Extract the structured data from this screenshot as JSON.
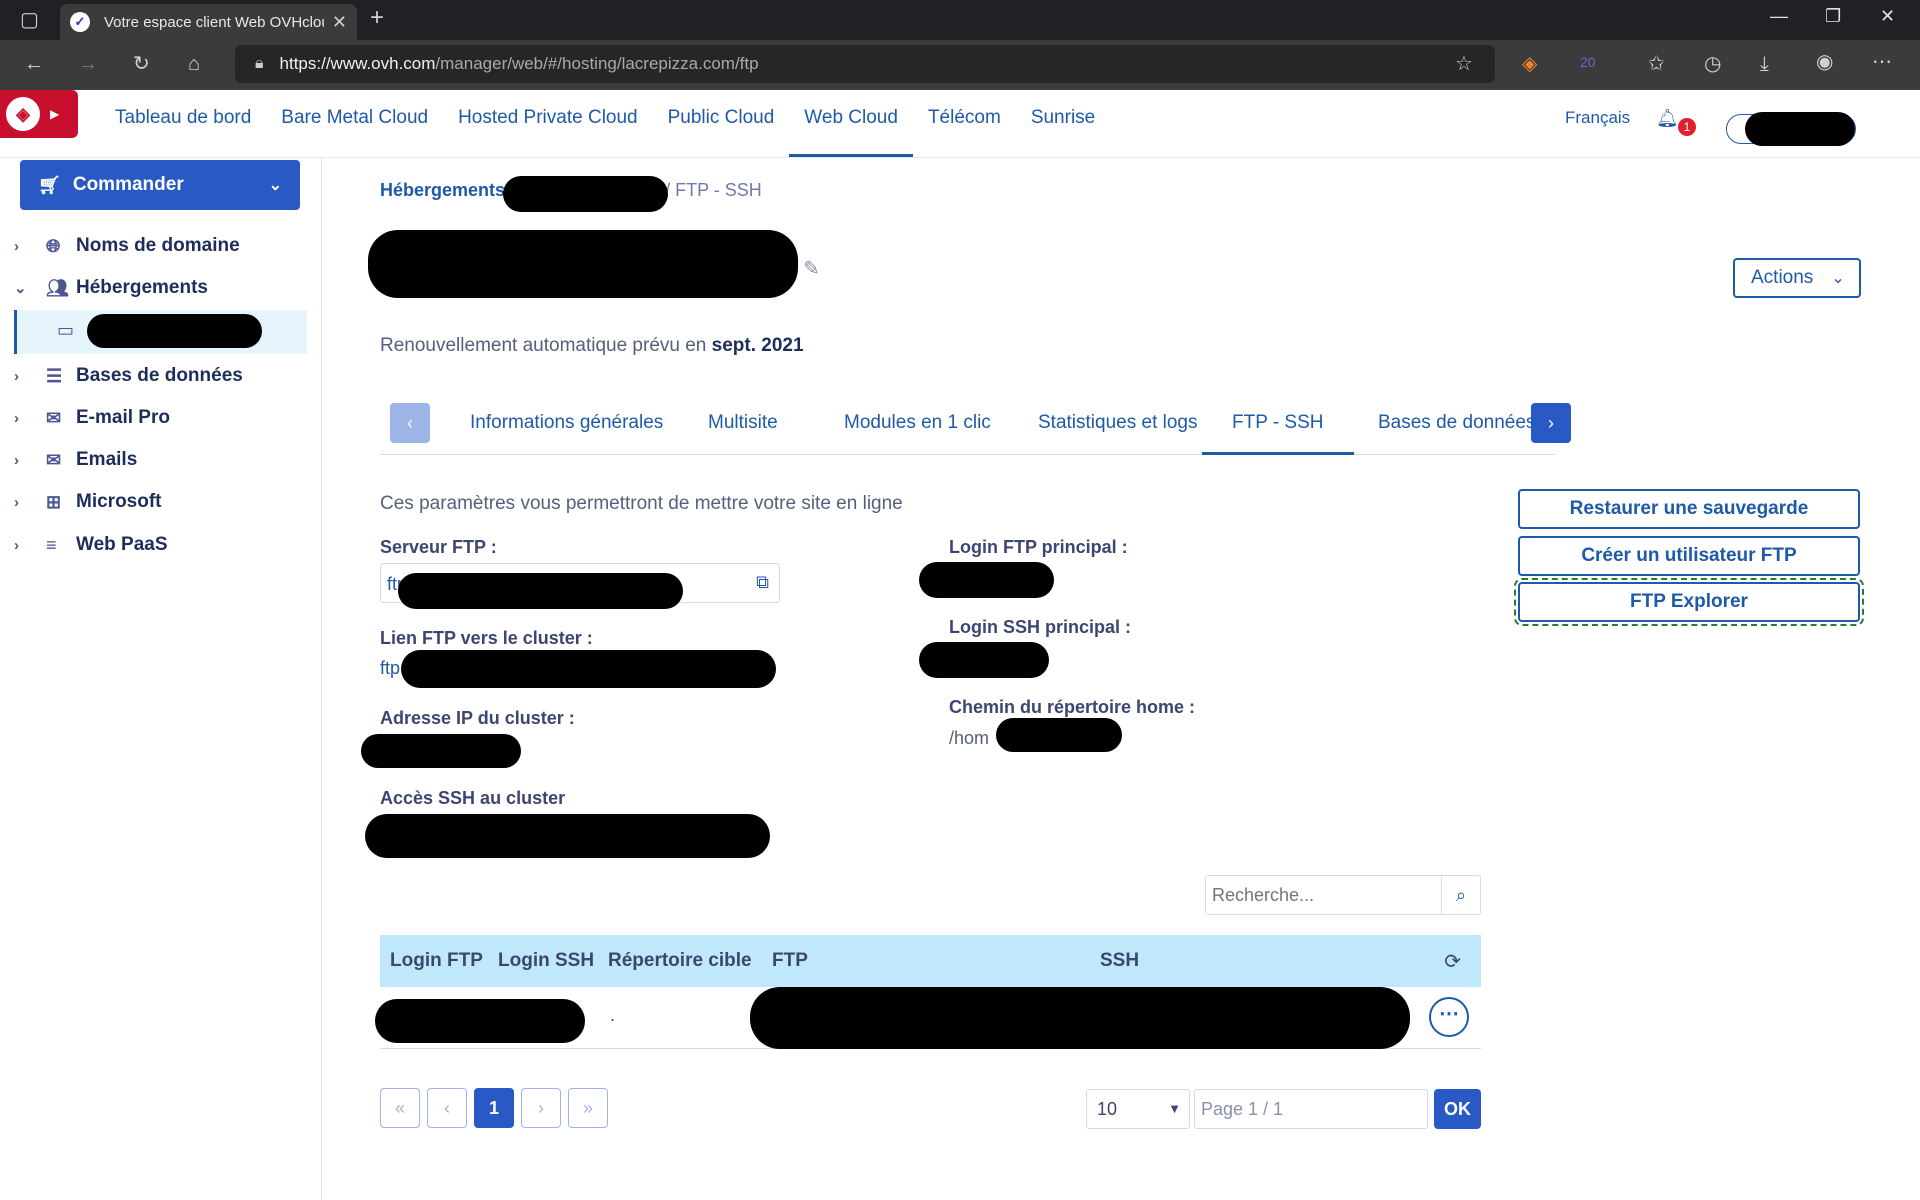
{
  "browser": {
    "tab_title": "Votre espace client Web OVHcloud",
    "url_host": "https://www.ovh.com",
    "url_path": "/manager/web/#/hosting/lacrepizza.com/ftp",
    "extension_badge": "20"
  },
  "header": {
    "nav": [
      "Tableau de bord",
      "Bare Metal Cloud",
      "Hosted Private Cloud",
      "Public Cloud",
      "Web Cloud",
      "Télécom",
      "Sunrise"
    ],
    "active_nav": "Web Cloud",
    "language": "Français",
    "notifications": "1"
  },
  "sidebar": {
    "order_label": "Commander",
    "items": [
      {
        "label": "Noms de domaine",
        "icon": "globe-icon"
      },
      {
        "label": "Hébergements",
        "icon": "users-icon"
      },
      {
        "label": "Bases de données",
        "icon": "database-icon"
      },
      {
        "label": "E-mail Pro",
        "icon": "mail-icon"
      },
      {
        "label": "Emails",
        "icon": "mail-icon"
      },
      {
        "label": "Microsoft",
        "icon": "windows-icon"
      },
      {
        "label": "Web PaaS",
        "icon": "layers-icon"
      }
    ]
  },
  "main": {
    "breadcrumb_root": "Hébergements",
    "breadcrumb_current": "/ FTP - SSH",
    "actions_label": "Actions",
    "renewal_prefix": "Renouvellement automatique prévu en",
    "renewal_date": "sept. 2021",
    "tabs": [
      "Informations générales",
      "Multisite",
      "Modules en 1 clic",
      "Statistiques et logs",
      "FTP - SSH",
      "Bases de données"
    ],
    "active_tab": "FTP - SSH",
    "hint": "Ces paramètres vous permettront de mettre votre site en ligne",
    "fields": {
      "ftp_server_label": "Serveur FTP :",
      "ftp_server_prefix": "ftp",
      "ftp_link_label": "Lien FTP vers le cluster :",
      "ftp_link_prefix": "ftp",
      "cluster_ip_label": "Adresse IP du cluster :",
      "ssh_access_label": "Accès SSH au cluster",
      "ftp_login_label": "Login FTP principal :",
      "ssh_login_label": "Login SSH principal :",
      "home_label": "Chemin du répertoire home :",
      "home_prefix": "/hom"
    },
    "buttons": {
      "restore": "Restaurer une sauvegarde",
      "create_user": "Créer un utilisateur FTP",
      "explorer": "FTP Explorer"
    },
    "search_placeholder": "Recherche...",
    "table": {
      "headers": [
        "Login FTP",
        "Login SSH",
        "Répertoire cible",
        "FTP",
        "SSH"
      ],
      "row": {
        "target_dir": "."
      }
    },
    "pagination": {
      "first": "«",
      "prev": "‹",
      "current": "1",
      "next": "›",
      "last": "»",
      "per_page": "10",
      "page_info": "Page 1 / 1",
      "ok": "OK"
    }
  }
}
